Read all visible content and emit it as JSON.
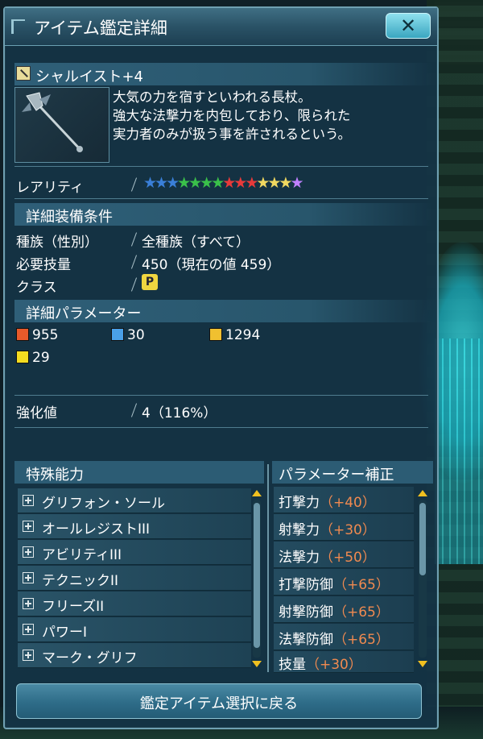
{
  "window": {
    "title": "アイテム鑑定詳細",
    "close_label": "✕"
  },
  "item": {
    "name": "シャルイスト+4",
    "description_lines": [
      "大気の力を宿すといわれる長杖。",
      "強大な法撃力を内包しており、限られた",
      "実力者のみが扱う事を許されるという。"
    ]
  },
  "rarity": {
    "label": "レアリティ",
    "stars": 13
  },
  "requirements": {
    "header": "詳細装備条件",
    "rows": [
      {
        "label": "種族（性別）",
        "value": "全種族（すべて）"
      },
      {
        "label": "必要技量",
        "value": "450（現在の値 459）"
      },
      {
        "label": "クラス",
        "value": "P"
      }
    ]
  },
  "parameters": {
    "header": "詳細パラメーター",
    "items": [
      {
        "icon": "melee-attack-icon",
        "value": "955"
      },
      {
        "icon": "ranged-attack-icon",
        "value": "30"
      },
      {
        "icon": "tech-attack-icon",
        "value": "1294"
      },
      {
        "icon": "element-lightning-icon",
        "value": "29"
      }
    ]
  },
  "grind": {
    "label": "強化値",
    "value": "4（116%）"
  },
  "special_abilities": {
    "header": "特殊能力",
    "items": [
      "グリフォン・ソール",
      "オールレジストIII",
      "アビリティIII",
      "テクニックII",
      "フリーズII",
      "パワーI",
      "マーク・グリフ"
    ]
  },
  "param_bonus": {
    "header": "パラメーター補正",
    "items": [
      {
        "name": "打撃力",
        "value": "（+40）"
      },
      {
        "name": "射撃力",
        "value": "（+30）"
      },
      {
        "name": "法撃力",
        "value": "（+50）"
      },
      {
        "name": "打撃防御",
        "value": "（+65）"
      },
      {
        "name": "射撃防御",
        "value": "（+65）"
      },
      {
        "name": "法撃防御",
        "value": "（+65）"
      },
      {
        "name": "技量",
        "value": "（+30）"
      }
    ]
  },
  "footer": {
    "back_label": "鑑定アイテム選択に戻る"
  },
  "colors": {
    "accent": "#3aa6c0",
    "bonus_value": "#f08a50",
    "scroll_arrow": "#f0c020"
  }
}
